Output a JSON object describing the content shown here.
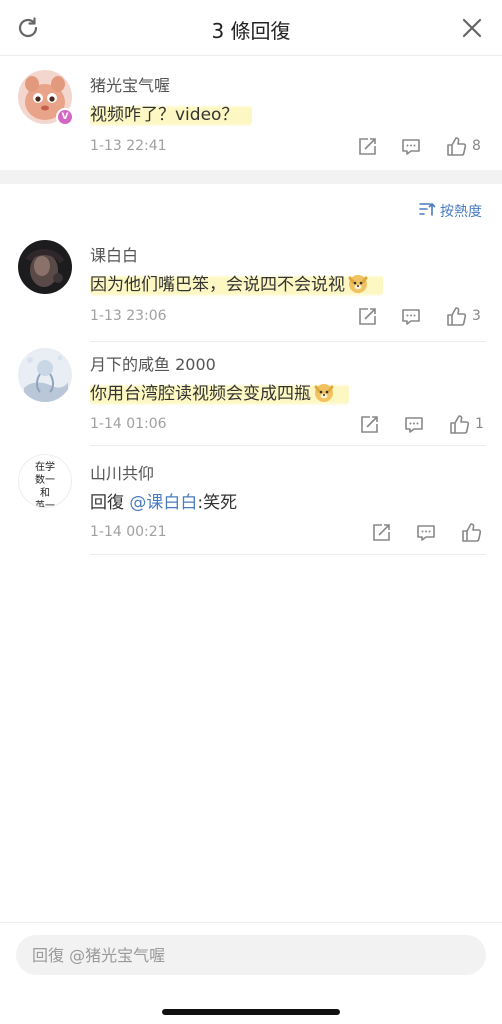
{
  "header": {
    "title": "3 條回復"
  },
  "main_comment": {
    "username": "猪光宝气喔",
    "text": "视频咋了？video？",
    "time": "1-13 22:41",
    "likes": "8"
  },
  "sort": {
    "label": "按熱度"
  },
  "replies": [
    {
      "username": "课白白",
      "text": "因为他们嘴巴笨，会说四不会说视",
      "time": "1-13 23:06",
      "likes": "3"
    },
    {
      "username": "月下的咸鱼 2000",
      "text": "你用台湾腔读视频会变成四瓶",
      "time": "1-14 01:06",
      "likes": "1"
    },
    {
      "username": "山川共仰",
      "text_prefix": "回復",
      "mention": "@课白白",
      "text_suffix": ":笑死",
      "time": "1-14 00:21",
      "likes": ""
    }
  ],
  "avatar3_text": [
    "在学",
    "数一",
    "和",
    "英一"
  ],
  "reply_box": {
    "placeholder": "回復 @猪光宝气喔"
  },
  "colors": {
    "link": "#4a7cc2",
    "highlight": "#fdf8c3",
    "vip_badge": "#d567c4"
  }
}
